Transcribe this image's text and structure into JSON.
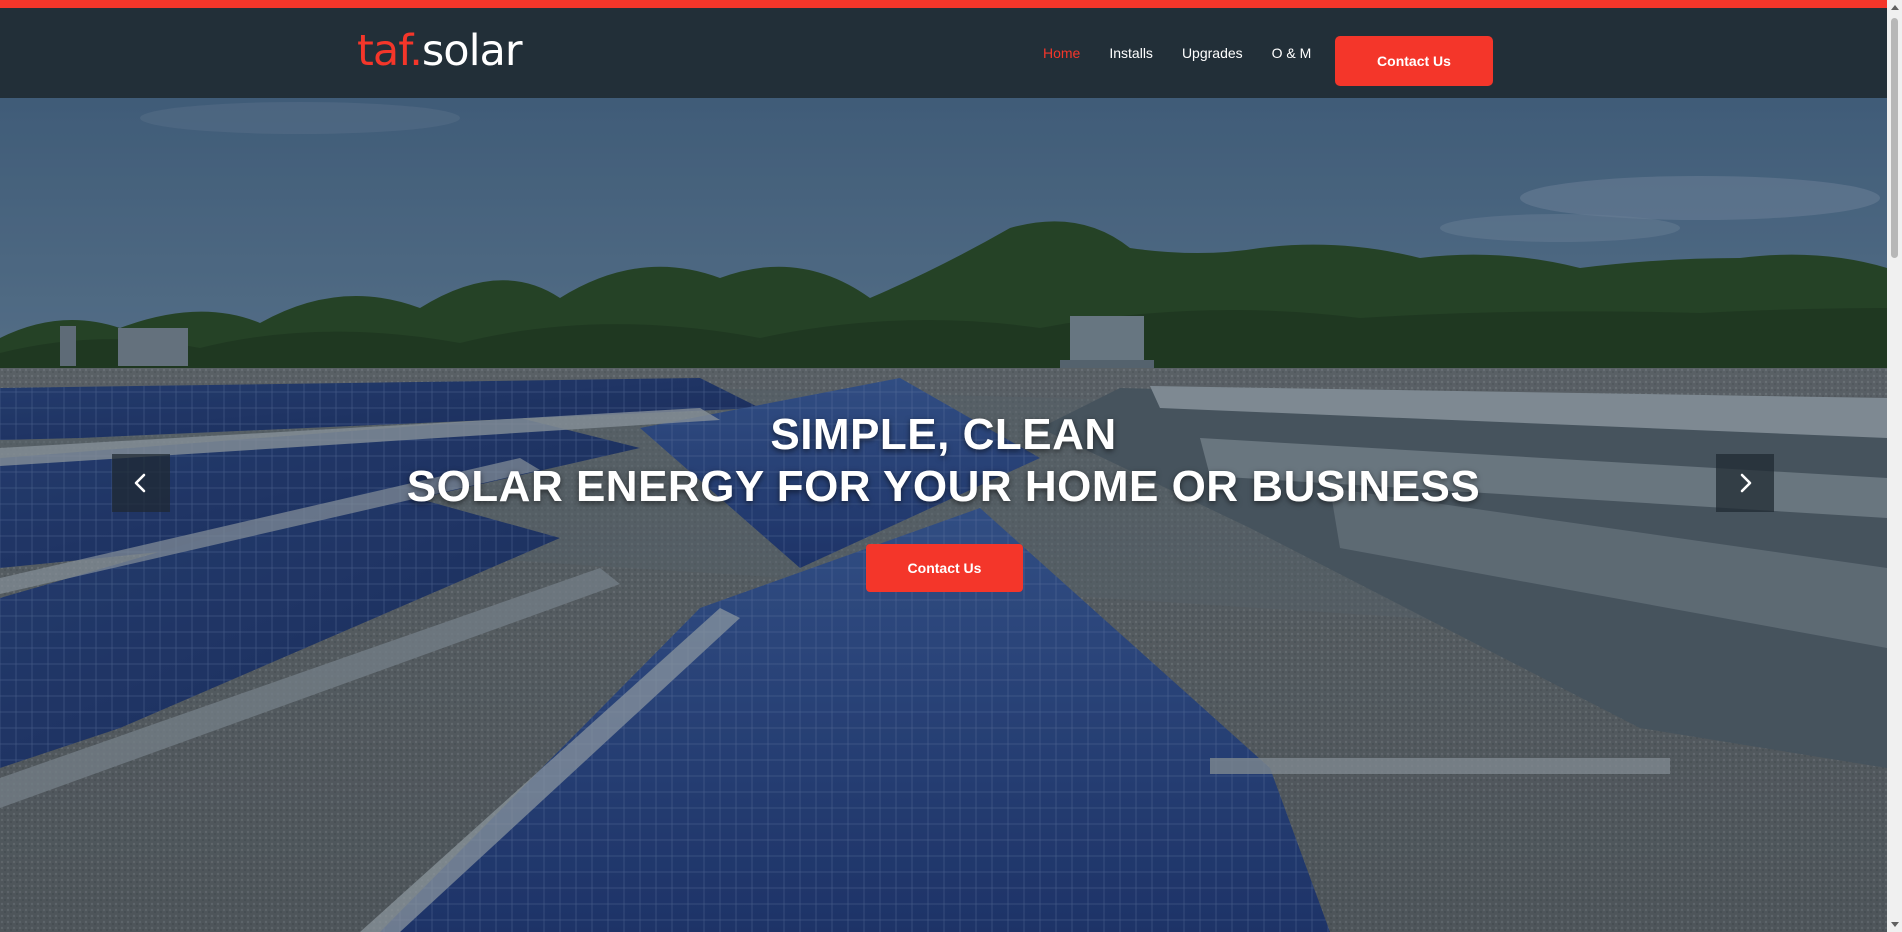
{
  "colors": {
    "accent": "#f4362a",
    "navbar_bg": "#202c34",
    "text_light": "#ffffff"
  },
  "header": {
    "logo": {
      "part1": "taf.",
      "part2": "solar"
    },
    "nav": [
      {
        "label": "Home",
        "active": true
      },
      {
        "label": "Installs",
        "active": false
      },
      {
        "label": "Upgrades",
        "active": false
      },
      {
        "label": "O & M",
        "active": false
      }
    ],
    "cta_label": "Contact Us"
  },
  "hero": {
    "line1": "SIMPLE, CLEAN",
    "line2": "SOLAR ENERGY FOR YOUR HOME OR BUSINESS",
    "cta_label": "Contact Us",
    "prev_icon": "chevron-left-icon",
    "next_icon": "chevron-right-icon"
  }
}
